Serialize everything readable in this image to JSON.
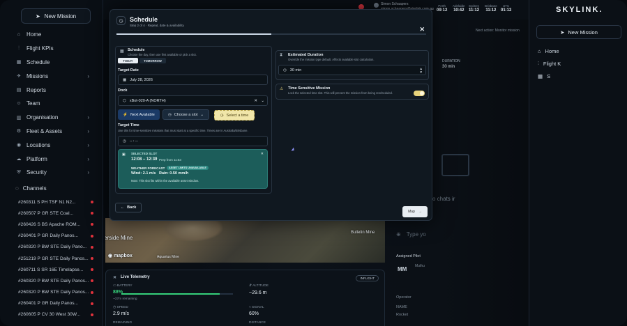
{
  "sidebar": {
    "new_mission": "New Mission",
    "items": [
      {
        "label": "Home",
        "icon": "home-icon",
        "chev": false
      },
      {
        "label": "Flight KPIs",
        "icon": "chart-icon",
        "chev": false
      },
      {
        "label": "Schedule",
        "icon": "calendar-icon",
        "chev": false
      },
      {
        "label": "Missions",
        "icon": "mission-icon",
        "chev": true
      },
      {
        "label": "Reports",
        "icon": "report-icon",
        "chev": false
      },
      {
        "label": "Team",
        "icon": "team-icon",
        "chev": false
      },
      {
        "label": "Organisation",
        "icon": "building-icon",
        "chev": true
      },
      {
        "label": "Fleet & Assets",
        "icon": "fleet-icon",
        "chev": true
      },
      {
        "label": "Locations",
        "icon": "location-icon",
        "chev": true
      },
      {
        "label": "Platform",
        "icon": "platform-icon",
        "chev": true
      },
      {
        "label": "Security",
        "icon": "shield-icon",
        "chev": true
      }
    ],
    "channels_title": "Channels",
    "channels": [
      "#260311 S PH TSF N1 N2...",
      "#260507 P GR STE Coal...",
      "#260426 S BS Apache ROM...",
      "#260401 P GR Daily Panos...",
      "#260320 P BW STE Daily Pano...",
      "#251219 P GR STE Daily Panos...",
      "#260711 S SR 16E Timelapse...",
      "#260320 P BW STE Daily Panos...",
      "#260320 P BW STE Daily Panos...",
      "#260401 P GR Daily Panos...",
      "#260605 P CV 30 West 30W..."
    ]
  },
  "topbar": {
    "user_name": "Simon Schaapers",
    "user_email": "simon.schaapers@skylink.com.au",
    "clocks": [
      {
        "label": "Perth",
        "time": "09:12"
      },
      {
        "label": "Adelaide",
        "time": "10:42"
      },
      {
        "label": "Sydney",
        "time": "11:12"
      },
      {
        "label": "Brisbane",
        "time": "11:12"
      },
      {
        "label": "UTC",
        "time": "01:12"
      }
    ]
  },
  "modal": {
    "title": "Schedule",
    "step": "Step 2 of 4 · Repeat, date & availability",
    "schedule_title": "Schedule",
    "schedule_sub": "Choose the day, then use first available or pick a slot.",
    "today": "TODAY",
    "tomorrow": "TOMORROW",
    "target_date_label": "Target Date",
    "target_date": "July 28, 2026",
    "dock_label": "Dock",
    "dock_value": "xBot-020-A (NORTH)",
    "next_available": "Next Available",
    "choose_slot": "Choose a slot",
    "select_time": "Select a time",
    "target_time_label": "Target Time",
    "target_time_sub": "Use this for time-sensitive missions that must start at a specific time. Times are in Australia/Brisbane.",
    "target_time_value": "-- : --",
    "selected_slot_label": "SELECTED SLOT",
    "slot_time": "12:08 – 12:39",
    "slot_prep": "Prep from 11:53",
    "weather_label": "WEATHER FORECAST",
    "weather_badge": "ASSET LIMITS UNAVAILABLE",
    "wind": "Wind: 2.1 m/s",
    "rain": "Rain: 0.50 mm/h",
    "slot_note": "Note: This slot fits within the available asset window.",
    "est_title": "Estimated Duration",
    "est_sub": "Override the mission type default. Affects available slot calculation.",
    "est_value": "30 min",
    "ts_title": "Time Sensitive Mission",
    "ts_sub": "Lock the selected time slot. This will prevent the mission from being rescheduled.",
    "back": "Back",
    "next": "Map"
  },
  "map": {
    "label1": "erside Mine",
    "label2": "Bulletin Mine",
    "logo": "mapbox",
    "small1": "Aquarius Mine"
  },
  "telemetry": {
    "title": "Live Telemetry",
    "badge": "INFLIGHT",
    "battery_label": "BATTERY",
    "battery": "88%",
    "remaining_sub": "~37m remaining",
    "battery_level": 0.88,
    "altitude_label": "ALTITUDE",
    "altitude": "~29.6 m",
    "speed_label": "SPEED",
    "speed": "2.9 m/s",
    "signal_label": "SIGNAL",
    "signal": "60%",
    "remaining_label": "REMAINING",
    "distance_label": "DISTANCE"
  },
  "right": {
    "brand": "SKYLINK.",
    "new_mission": "New Mission",
    "items": [
      "Home",
      "Flight K",
      "S"
    ],
    "next_action": "Next action: Monitor mission",
    "duration_label": "DURATION",
    "duration": "30 min",
    "type_placeholder": "Type yo",
    "chat_text": "o chats ir",
    "assigned_pilot": "Assigned Pilot",
    "pilot_initials": "MM",
    "pilot_name": "Muthu",
    "operator": "Operator",
    "name_lbl": "NAME",
    "rocket": "Rocket"
  },
  "colors": {
    "accent": "#36d07a",
    "slot": "#1c5d5a",
    "select_time": "#e7d27a",
    "alert": "#e0323c"
  }
}
